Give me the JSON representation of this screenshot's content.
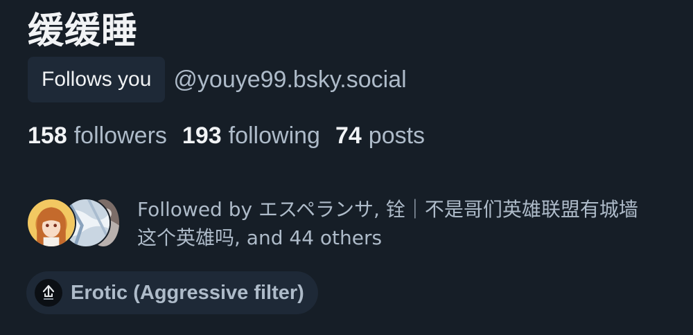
{
  "profile": {
    "display_name": "缓缓睡",
    "follows_you_label": "Follows you",
    "handle": "@youye99.bsky.social"
  },
  "stats": {
    "followers_count": "158",
    "followers_label": "followers",
    "following_count": "193",
    "following_label": "following",
    "posts_count": "74",
    "posts_label": "posts"
  },
  "followed_by": {
    "text": "Followed by エスペランサ, 铨｜不是哥们英雄联盟有城墙这个英雄吗, and 44 others",
    "avatars": [
      "avatar-anime-girl",
      "avatar-sky-clouds",
      "avatar-gray-photo"
    ]
  },
  "moderation": {
    "label": "Erotic (Aggressive filter)",
    "icon": "labeler-logo-icon"
  },
  "colors": {
    "background": "#161e27",
    "chip_background": "#1e2937",
    "primary_text": "#f1f3f5",
    "secondary_text": "#aebbc9"
  }
}
